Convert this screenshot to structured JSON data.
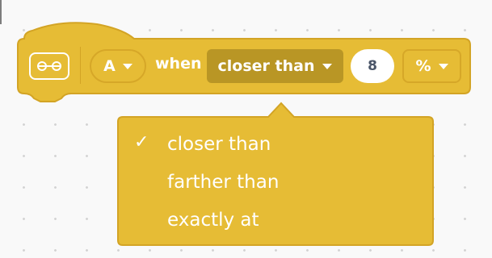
{
  "block": {
    "sensor_icon": "distance-sensor-icon",
    "port": {
      "value": "A"
    },
    "when_label": "when",
    "mode": {
      "value": "closer than"
    },
    "threshold": {
      "value": "8"
    },
    "unit": {
      "value": "%"
    }
  },
  "dropdown": {
    "selected_index": 0,
    "check_glyph": "✓",
    "options": [
      "closer than",
      "farther than",
      "exactly at"
    ]
  },
  "colors": {
    "block_fill": "#e6bc35",
    "block_stroke": "#d3a425",
    "field_dark": "#b99625",
    "background": "#f9f9f9"
  }
}
